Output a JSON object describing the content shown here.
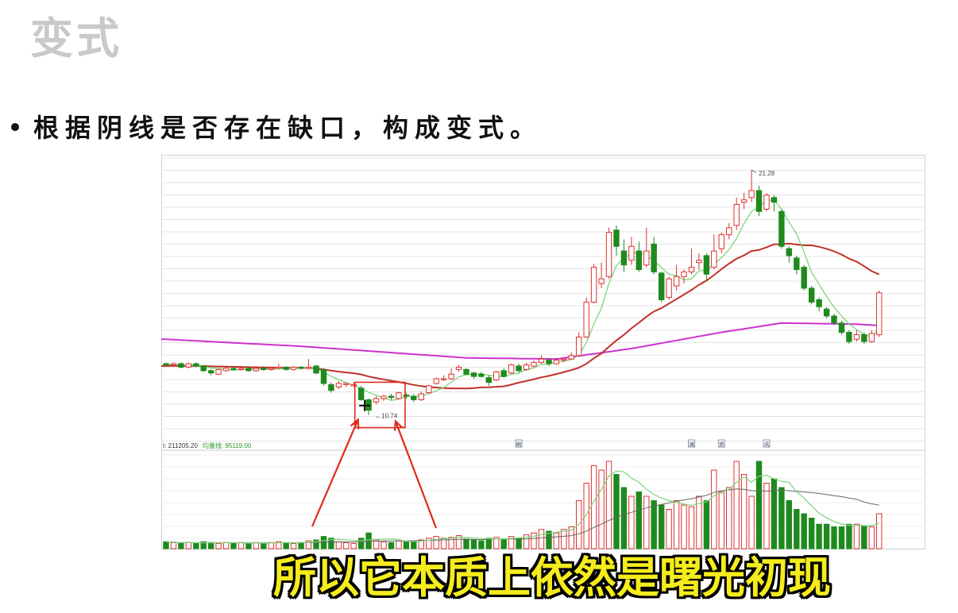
{
  "slide": {
    "title": "变式",
    "bullet": "根据阴线是否存在缺口，构成变式。"
  },
  "subtitle": "所以它本质上依然是曙光初现",
  "chart_data": {
    "type": "candlestick",
    "high_label": "21.28",
    "low_label": "10.74",
    "volume_panel": {
      "label_prefix": "211205.20",
      "ma_label": "均量线: 95119.00"
    },
    "markers": [
      "刷",
      "减",
      "资",
      "讯"
    ],
    "colors": {
      "up": "#e03030",
      "down": "#1e8a1e",
      "ma5": "#7ad67a",
      "ma20": "#c0302a",
      "ma60": "#cc33cc",
      "annotation": "#e02a1a"
    },
    "ylim": [
      9.5,
      21.8
    ],
    "candles": [
      [
        12.95,
        12.9,
        13.0,
        12.85
      ],
      [
        12.9,
        12.95,
        13.0,
        12.85
      ],
      [
        12.95,
        12.8,
        13.0,
        12.75
      ],
      [
        12.8,
        12.95,
        13.0,
        12.75
      ],
      [
        12.95,
        12.85,
        13.0,
        12.8
      ],
      [
        12.85,
        12.65,
        12.9,
        12.6
      ],
      [
        12.65,
        12.55,
        12.7,
        12.45
      ],
      [
        12.5,
        12.7,
        12.75,
        12.45
      ],
      [
        12.65,
        12.75,
        12.8,
        12.6
      ],
      [
        12.75,
        12.7,
        12.8,
        12.65
      ],
      [
        12.7,
        12.75,
        12.8,
        12.65
      ],
      [
        12.75,
        12.65,
        12.8,
        12.6
      ],
      [
        12.65,
        12.75,
        12.8,
        12.6
      ],
      [
        12.75,
        12.7,
        12.85,
        12.65
      ],
      [
        12.7,
        12.75,
        12.8,
        12.65
      ],
      [
        12.75,
        12.8,
        12.95,
        12.7
      ],
      [
        12.8,
        12.7,
        12.85,
        12.65
      ],
      [
        12.7,
        12.8,
        12.85,
        12.65
      ],
      [
        12.8,
        12.75,
        12.85,
        12.7
      ],
      [
        12.75,
        12.8,
        13.15,
        12.7
      ],
      [
        12.85,
        12.55,
        12.9,
        12.5
      ],
      [
        12.7,
        12.1,
        12.75,
        12.0
      ],
      [
        12.05,
        11.8,
        12.15,
        11.7
      ],
      [
        11.95,
        12.1,
        12.2,
        11.85
      ],
      [
        12.05,
        12.1,
        12.15,
        11.95
      ],
      [
        12.0,
        12.05,
        12.15,
        11.95
      ],
      [
        11.9,
        11.4,
        12.0,
        11.35
      ],
      [
        11.4,
        10.95,
        11.45,
        10.74
      ],
      [
        11.3,
        11.45,
        11.55,
        11.2
      ],
      [
        11.45,
        11.55,
        11.6,
        11.35
      ],
      [
        11.55,
        11.5,
        11.65,
        11.4
      ],
      [
        11.45,
        11.7,
        11.75,
        11.4
      ],
      [
        11.6,
        11.55,
        11.7,
        11.45
      ],
      [
        11.55,
        11.4,
        11.65,
        11.3
      ],
      [
        11.4,
        11.65,
        11.75,
        11.35
      ],
      [
        11.7,
        12.0,
        12.05,
        11.65
      ],
      [
        12.1,
        12.3,
        12.35,
        12.05
      ],
      [
        12.3,
        12.3,
        12.45,
        12.2
      ],
      [
        12.3,
        12.5,
        12.75,
        12.25
      ],
      [
        12.7,
        12.8,
        12.9,
        12.6
      ],
      [
        12.7,
        12.5,
        12.75,
        12.45
      ],
      [
        12.55,
        12.4,
        12.6,
        12.3
      ],
      [
        12.5,
        12.4,
        12.6,
        12.35
      ],
      [
        12.35,
        12.15,
        12.45,
        12.0
      ],
      [
        12.25,
        12.6,
        12.65,
        12.2
      ],
      [
        12.65,
        12.4,
        12.75,
        12.35
      ],
      [
        12.55,
        12.9,
        12.95,
        12.5
      ],
      [
        12.85,
        12.65,
        12.95,
        12.55
      ],
      [
        12.7,
        12.9,
        13.0,
        12.65
      ],
      [
        12.85,
        13.0,
        13.1,
        12.8
      ],
      [
        13.0,
        13.15,
        13.3,
        12.95
      ],
      [
        13.1,
        12.95,
        13.2,
        12.85
      ],
      [
        12.95,
        13.1,
        13.2,
        12.9
      ],
      [
        13.1,
        13.15,
        13.2,
        13.0
      ],
      [
        13.15,
        13.3,
        13.45,
        13.1
      ],
      [
        13.3,
        14.1,
        14.3,
        13.25
      ],
      [
        14.1,
        15.6,
        15.8,
        14.05
      ],
      [
        15.6,
        17.1,
        17.25,
        15.55
      ],
      [
        16.4,
        16.6,
        17.3,
        16.2
      ],
      [
        16.7,
        18.6,
        18.8,
        16.6
      ],
      [
        18.7,
        18.0,
        18.9,
        17.6
      ],
      [
        17.8,
        17.2,
        18.3,
        16.9
      ],
      [
        17.4,
        18.0,
        18.4,
        17.2
      ],
      [
        17.8,
        17.0,
        18.2,
        16.9
      ],
      [
        17.2,
        17.8,
        18.8,
        17.1
      ],
      [
        18.1,
        16.9,
        18.4,
        16.8
      ],
      [
        16.85,
        15.7,
        16.9,
        15.6
      ],
      [
        15.8,
        16.6,
        16.7,
        15.7
      ],
      [
        16.3,
        16.7,
        17.2,
        16.1
      ],
      [
        16.7,
        16.9,
        17.0,
        16.4
      ],
      [
        16.9,
        17.1,
        17.9,
        16.8
      ],
      [
        17.3,
        17.4,
        17.7,
        17.0
      ],
      [
        17.6,
        16.8,
        17.7,
        16.5
      ],
      [
        17.1,
        17.8,
        18.5,
        17.0
      ],
      [
        17.9,
        18.5,
        18.6,
        17.7
      ],
      [
        18.5,
        18.8,
        19.0,
        18.3
      ],
      [
        18.9,
        19.8,
        20.1,
        18.7
      ],
      [
        19.9,
        20.0,
        20.3,
        19.6
      ],
      [
        20.1,
        20.4,
        21.28,
        19.9
      ],
      [
        20.4,
        19.5,
        20.6,
        19.3
      ],
      [
        19.6,
        20.2,
        20.3,
        19.5
      ],
      [
        20.1,
        19.9,
        20.2,
        19.5
      ],
      [
        19.5,
        18.0,
        19.6,
        17.9
      ],
      [
        17.9,
        17.6,
        18.0,
        17.3
      ],
      [
        17.5,
        17.0,
        17.6,
        16.8
      ],
      [
        17.1,
        16.2,
        17.2,
        16.1
      ],
      [
        16.2,
        15.6,
        16.3,
        15.5
      ],
      [
        15.7,
        15.4,
        15.8,
        15.2
      ],
      [
        15.3,
        15.0,
        15.4,
        14.9
      ],
      [
        15.0,
        14.7,
        15.1,
        14.6
      ],
      [
        14.7,
        14.3,
        14.8,
        14.2
      ],
      [
        14.3,
        13.9,
        14.4,
        13.8
      ],
      [
        14.0,
        14.2,
        14.4,
        13.9
      ],
      [
        14.2,
        13.9,
        14.3,
        13.8
      ],
      [
        13.9,
        14.25,
        14.4,
        13.85
      ],
      [
        14.2,
        16.0,
        16.1,
        14.1
      ]
    ],
    "volume": [
      8,
      7,
      6,
      7,
      6,
      8,
      7,
      6,
      7,
      6,
      7,
      6,
      7,
      6,
      7,
      8,
      7,
      6,
      7,
      9,
      10,
      14,
      12,
      8,
      7,
      6,
      12,
      18,
      10,
      8,
      7,
      9,
      8,
      9,
      10,
      12,
      14,
      12,
      13,
      15,
      11,
      10,
      9,
      12,
      13,
      11,
      14,
      12,
      16,
      18,
      22,
      20,
      18,
      22,
      25,
      55,
      75,
      95,
      90,
      100,
      85,
      70,
      60,
      65,
      60,
      55,
      50,
      45,
      55,
      50,
      48,
      60,
      55,
      90,
      65,
      70,
      100,
      85,
      60,
      100,
      75,
      80,
      70,
      55,
      45,
      40,
      35,
      28,
      28,
      25,
      25,
      28,
      28,
      26,
      25,
      40
    ],
    "ma20_start": 12.85,
    "ma60": [
      [
        0,
        14.0
      ],
      [
        18,
        13.7
      ],
      [
        40,
        13.2
      ],
      [
        52,
        13.15
      ],
      [
        62,
        13.6
      ],
      [
        74,
        14.3
      ],
      [
        82,
        14.7
      ],
      [
        92,
        14.65
      ],
      [
        97,
        14.55
      ]
    ],
    "markers_index": [
      47,
      70,
      74,
      80
    ]
  }
}
